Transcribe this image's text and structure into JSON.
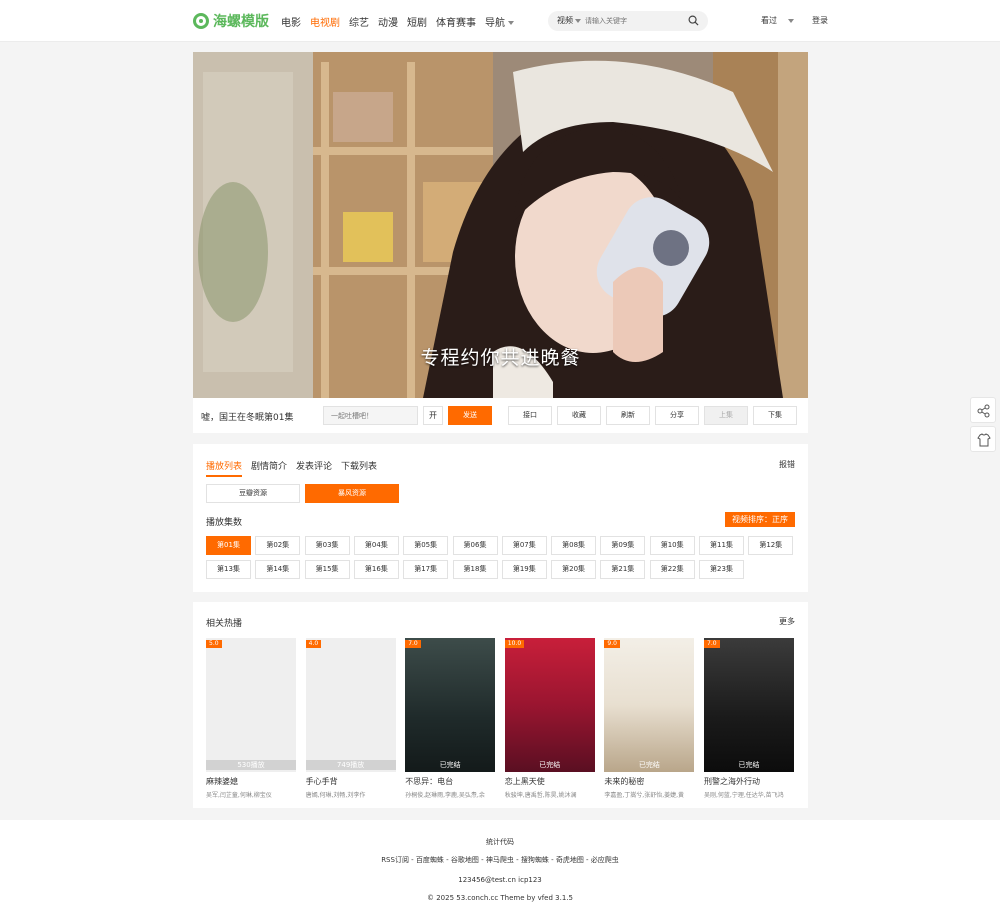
{
  "header": {
    "logo_text": "海螺模版",
    "nav": [
      "电影",
      "电视剧",
      "综艺",
      "动漫",
      "短剧",
      "体育赛事",
      "导航"
    ],
    "nav_active": "电视剧",
    "search_type": "视频",
    "search_placeholder": "请输入关键字",
    "history_label": "看过",
    "login_label": "登录"
  },
  "player": {
    "subtitle": "专程约你共进晚餐"
  },
  "controls": {
    "title": "嘘，国王在冬眠第01集",
    "danmu_placeholder": "一起吐槽吧！",
    "toggle_label": "开",
    "send_label": "发送",
    "buttons": [
      "接口",
      "收藏",
      "刷新",
      "分享",
      "上集",
      "下集"
    ]
  },
  "episodes_panel": {
    "tabs": [
      "播放列表",
      "剧情简介",
      "发表评论",
      "下载列表"
    ],
    "report_label": "报错",
    "sources": [
      "豆瓣资源",
      "暴风资源"
    ],
    "episodes_heading": "播放集数",
    "sort_label": "视频排序：正序",
    "episodes": [
      "第01集",
      "第02集",
      "第03集",
      "第04集",
      "第05集",
      "第06集",
      "第07集",
      "第08集",
      "第09集",
      "第10集",
      "第11集",
      "第12集",
      "第13集",
      "第14集",
      "第15集",
      "第16集",
      "第17集",
      "第18集",
      "第19集",
      "第20集",
      "第21集",
      "第22集",
      "第23集"
    ]
  },
  "related": {
    "title": "相关热播",
    "more_label": "更多",
    "items": [
      {
        "name": "麻辣婆媳",
        "cast": "吴军,闫芷童,何琳,柳宝仪",
        "score": "5.0",
        "note": "530播放",
        "poster": "blank"
      },
      {
        "name": "手心手背",
        "cast": "唐嫣,何琳,刘畅,刘李作",
        "score": "4.0",
        "note": "749播放",
        "poster": "blank"
      },
      {
        "name": "不思异：电台",
        "cast": "孙桐俊,赵琳雨,李鹿,吴弘焘,余",
        "score": "7.0",
        "note": "已完结",
        "poster": "dark"
      },
      {
        "name": "恋上黑天使",
        "cast": "秋骏坤,唐禹哲,陈昊,姚沐澜",
        "score": "10.0",
        "note": "已完结",
        "poster": "red"
      },
      {
        "name": "未来的秘密",
        "cast": "李嘉盈,丁嵩兮,张舒怡,姜婕,黄",
        "score": "9.0",
        "note": "已完结",
        "poster": "light"
      },
      {
        "name": "刑警之海外行动",
        "cast": "吴刚,何蓝,宁理,任达华,苗飞鸿",
        "score": "7.0",
        "note": "已完结",
        "poster": "black"
      }
    ]
  },
  "footer": {
    "stats": "统计代码",
    "links": "RSS订阅 - 百度蜘蛛 - 谷歌地图 - 神马爬虫 - 搜狗蜘蛛 - 奇虎地图 - 必应爬虫",
    "contact": "123456@test.cn    icp123",
    "copyright": "© 2025 53.conch.cc Theme by vfed 3.1.5"
  },
  "colors": {
    "accent": "#ff6a00",
    "logo": "#5cb85c"
  }
}
